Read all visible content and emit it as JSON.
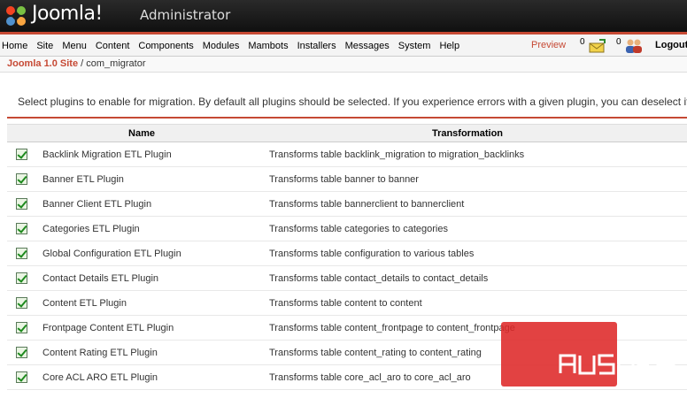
{
  "header": {
    "brand": "Joomla!",
    "subtitle": "Administrator"
  },
  "menu": {
    "items": [
      "Home",
      "Site",
      "Menu",
      "Content",
      "Components",
      "Modules",
      "Mambots",
      "Installers",
      "Messages",
      "System",
      "Help"
    ],
    "preview": "Preview",
    "messages_count": "0",
    "users_count": "0",
    "logout": "Logout"
  },
  "path": {
    "site": "Joomla 1.0 Site",
    "separator": " / ",
    "component": "com_migrator"
  },
  "intro": "Select plugins to enable for migration. By default all plugins should be selected. If you experience errors with a given plugin, you can deselect it",
  "table": {
    "headers": {
      "name": "Name",
      "transformation": "Transformation"
    },
    "rows": [
      {
        "name": "Backlink Migration ETL Plugin",
        "transformation": "Transforms table backlink_migration to migration_backlinks"
      },
      {
        "name": "Banner ETL Plugin",
        "transformation": "Transforms table banner to banner"
      },
      {
        "name": "Banner Client ETL Plugin",
        "transformation": "Transforms table bannerclient to bannerclient"
      },
      {
        "name": "Categories ETL Plugin",
        "transformation": "Transforms table categories to categories"
      },
      {
        "name": "Global Configuration ETL Plugin",
        "transformation": "Transforms table configuration to various tables"
      },
      {
        "name": "Contact Details ETL Plugin",
        "transformation": "Transforms table contact_details to contact_details"
      },
      {
        "name": "Content ETL Plugin",
        "transformation": "Transforms table content to content"
      },
      {
        "name": "Frontpage Content ETL Plugin",
        "transformation": "Transforms table content_frontpage to content_frontpage"
      },
      {
        "name": "Content Rating ETL Plugin",
        "transformation": "Transforms table content_rating to content_rating"
      },
      {
        "name": "Core ACL ARO ETL Plugin",
        "transformation": "Transforms table core_acl_aro to core_acl_aro"
      }
    ]
  },
  "watermark": "AUSWEB",
  "colors": {
    "accent": "#c64934",
    "check": "#1d8a1d",
    "watermark": "#de2828"
  }
}
